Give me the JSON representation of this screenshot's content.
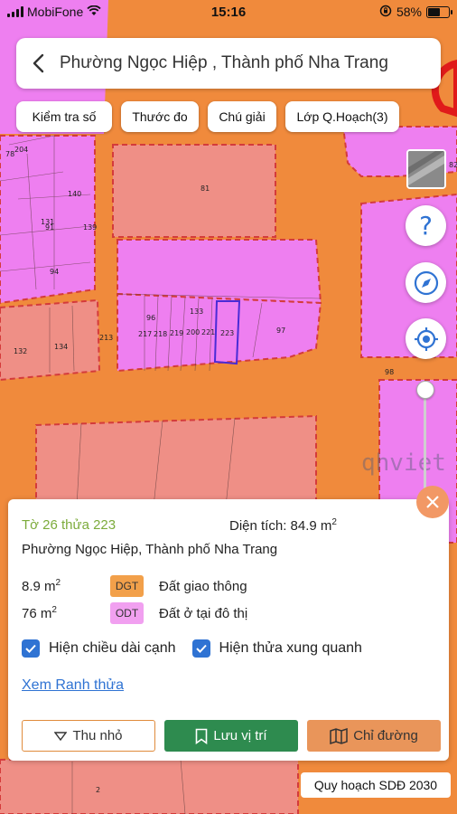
{
  "status_bar": {
    "carrier": "MobiFone",
    "time": "15:16",
    "battery_text": "58%",
    "battery_level": 0.58
  },
  "search": {
    "title": "Phường Ngọc Hiệp , Thành phố Nha Trang"
  },
  "toolbar": {
    "chips": [
      "Kiểm tra số",
      "Thước đo",
      "Chú giải",
      "Lớp Q.Hoạch(3)"
    ]
  },
  "map": {
    "watermark": "qhviet",
    "parcel_labels": [
      "204",
      "78",
      "140",
      "81",
      "131",
      "91",
      "139",
      "94",
      "96",
      "133",
      "217",
      "218",
      "219",
      "200",
      "221",
      "223",
      "97",
      "132",
      "134",
      "213",
      "98",
      "82",
      "2"
    ],
    "colors": {
      "road": "#f08a3c",
      "odt": "#ee7ff0",
      "commercial": "#ef8f86",
      "boundary_red": "#d43b3b"
    }
  },
  "controls": {
    "help_icon": "question-mark-icon",
    "compass_icon": "compass-icon",
    "location_icon": "locate-icon",
    "zoom_level": 0.95
  },
  "info": {
    "parcel_id": "Tờ 26 thửa 223",
    "area_label": "Diện tích: 84.9 m",
    "area_sup": "2",
    "address": "Phường Ngọc Hiệp, Thành phố Nha Trang",
    "land_uses": [
      {
        "area": "8.9 m",
        "sup": "2",
        "code": "DGT",
        "name": "Đất giao thông",
        "color": "#f2a04a"
      },
      {
        "area": "76 m",
        "sup": "2",
        "code": "ODT",
        "name": "Đất ở tại đô thị",
        "color": "#f1a0f0"
      }
    ],
    "checkbox_1": "Hiện chiều dài cạnh",
    "checkbox_2": "Hiện thửa xung quanh",
    "boundary_link": "Xem Ranh thửa",
    "btn_shrink": "Thu nhỏ",
    "btn_save": "Lưu vị trí",
    "btn_route": "Chỉ đường"
  },
  "plan_badge": "Quy hoạch SDĐ 2030"
}
